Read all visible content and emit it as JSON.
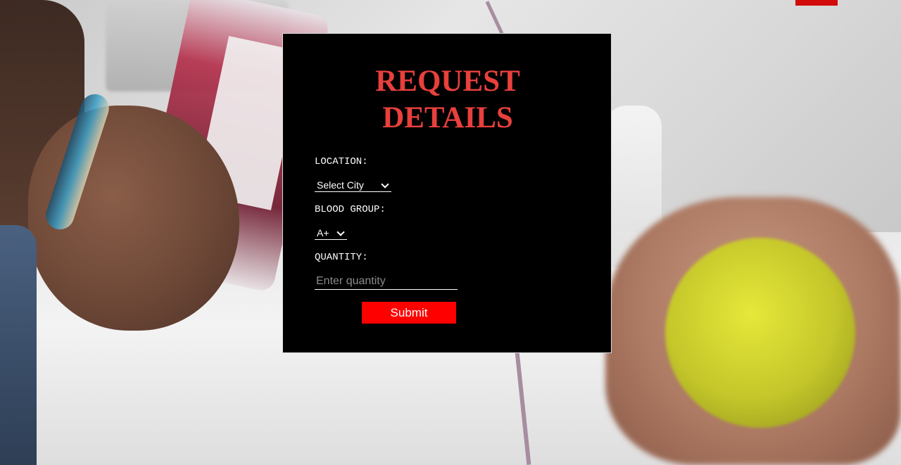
{
  "form": {
    "title_line1": "REQUEST",
    "title_line2": "DETAILS",
    "location_label": "LOCATION:",
    "location_selected": "Select City",
    "blood_group_label": "BLOOD GROUP:",
    "blood_group_selected": "A+",
    "quantity_label": "QUANTITY:",
    "quantity_placeholder": "Enter quantity",
    "quantity_value": "",
    "submit_label": "Submit"
  },
  "colors": {
    "title": "#e8403c",
    "submit_bg": "#ff0000",
    "panel_bg": "#000000"
  }
}
